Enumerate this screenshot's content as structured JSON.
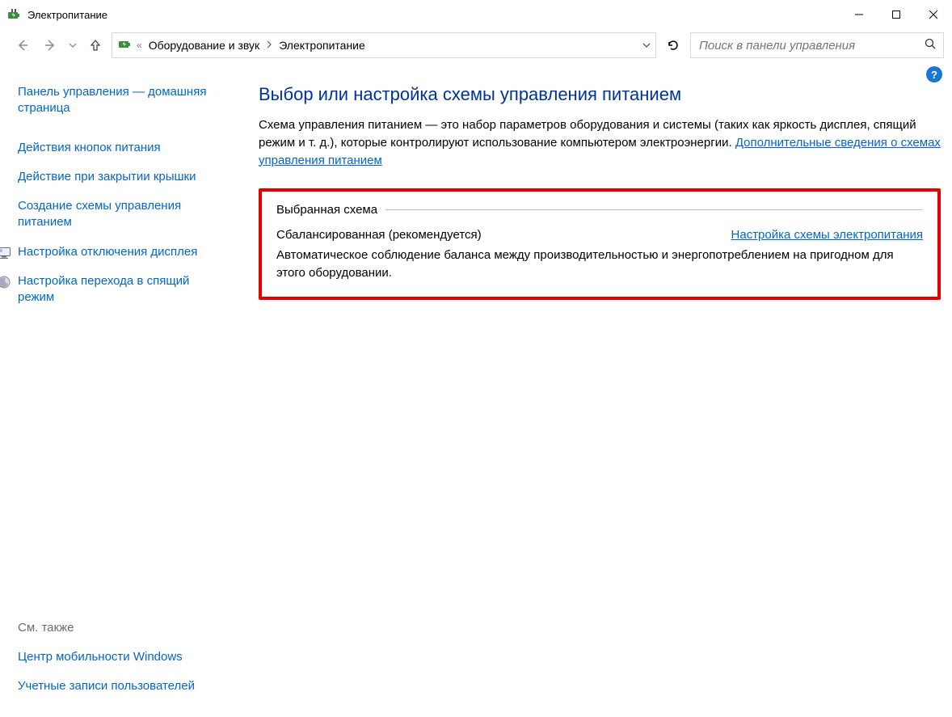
{
  "window": {
    "title": "Электропитание"
  },
  "breadcrumb": {
    "parent": "Оборудование и звук",
    "current": "Электропитание"
  },
  "search": {
    "placeholder": "Поиск в панели управления"
  },
  "sidebar": {
    "home": "Панель управления — домашняя страница",
    "links": {
      "power_buttons": "Действия кнопок питания",
      "lid_close": "Действие при закрытии крышки",
      "create_plan": "Создание схемы управления питанием",
      "display_off": "Настройка отключения дисплея",
      "sleep": "Настройка перехода в спящий режим"
    },
    "see_also": {
      "header": "См. также",
      "mobility": "Центр мобильности Windows",
      "accounts": "Учетные записи пользователей"
    }
  },
  "main": {
    "title": "Выбор или настройка схемы управления питанием",
    "intro_text": "Схема управления питанием — это набор параметров оборудования и системы (таких как яркость дисплея, спящий режим и т. д.), которые контролируют использование компьютером электроэнергии. ",
    "intro_link": "Дополнительные сведения о схемах управления питанием",
    "section_label": "Выбранная схема",
    "plan": {
      "name": "Сбалансированная (рекомендуется)",
      "change_link": "Настройка схемы электропитания",
      "desc": "Автоматическое соблюдение баланса между производительностью и энергопотреблением на пригодном для этого оборудовании."
    }
  }
}
